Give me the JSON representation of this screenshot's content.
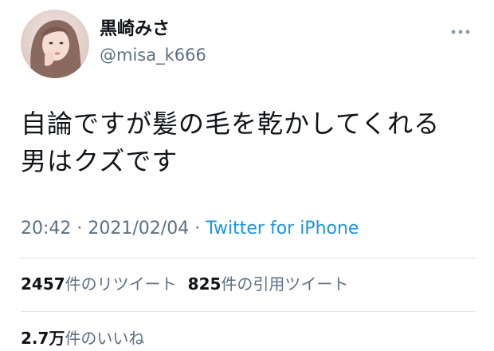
{
  "user": {
    "display_name": "黒崎みさ",
    "handle": "@misa_k666",
    "avatar_icon": "profile-photo"
  },
  "more_icon": "more-horizontal-icon",
  "tweet": {
    "text_lines": [
      "自論ですが髪の毛を乾かしてくれる",
      "男はクズです"
    ]
  },
  "meta": {
    "time": "20:42",
    "separator": "·",
    "date": "2021/02/04",
    "source": "Twitter for iPhone"
  },
  "stats": {
    "retweets": {
      "count": "2457",
      "label": "件のリツイート"
    },
    "quotes": {
      "count": "825",
      "label": "件の引用ツイート"
    },
    "likes": {
      "count": "2.7万",
      "label": "件のいいね"
    }
  },
  "colors": {
    "text": "#0f1419",
    "secondary": "#5b7083",
    "link": "#1b95e0",
    "divider": "#dfe3e7"
  }
}
